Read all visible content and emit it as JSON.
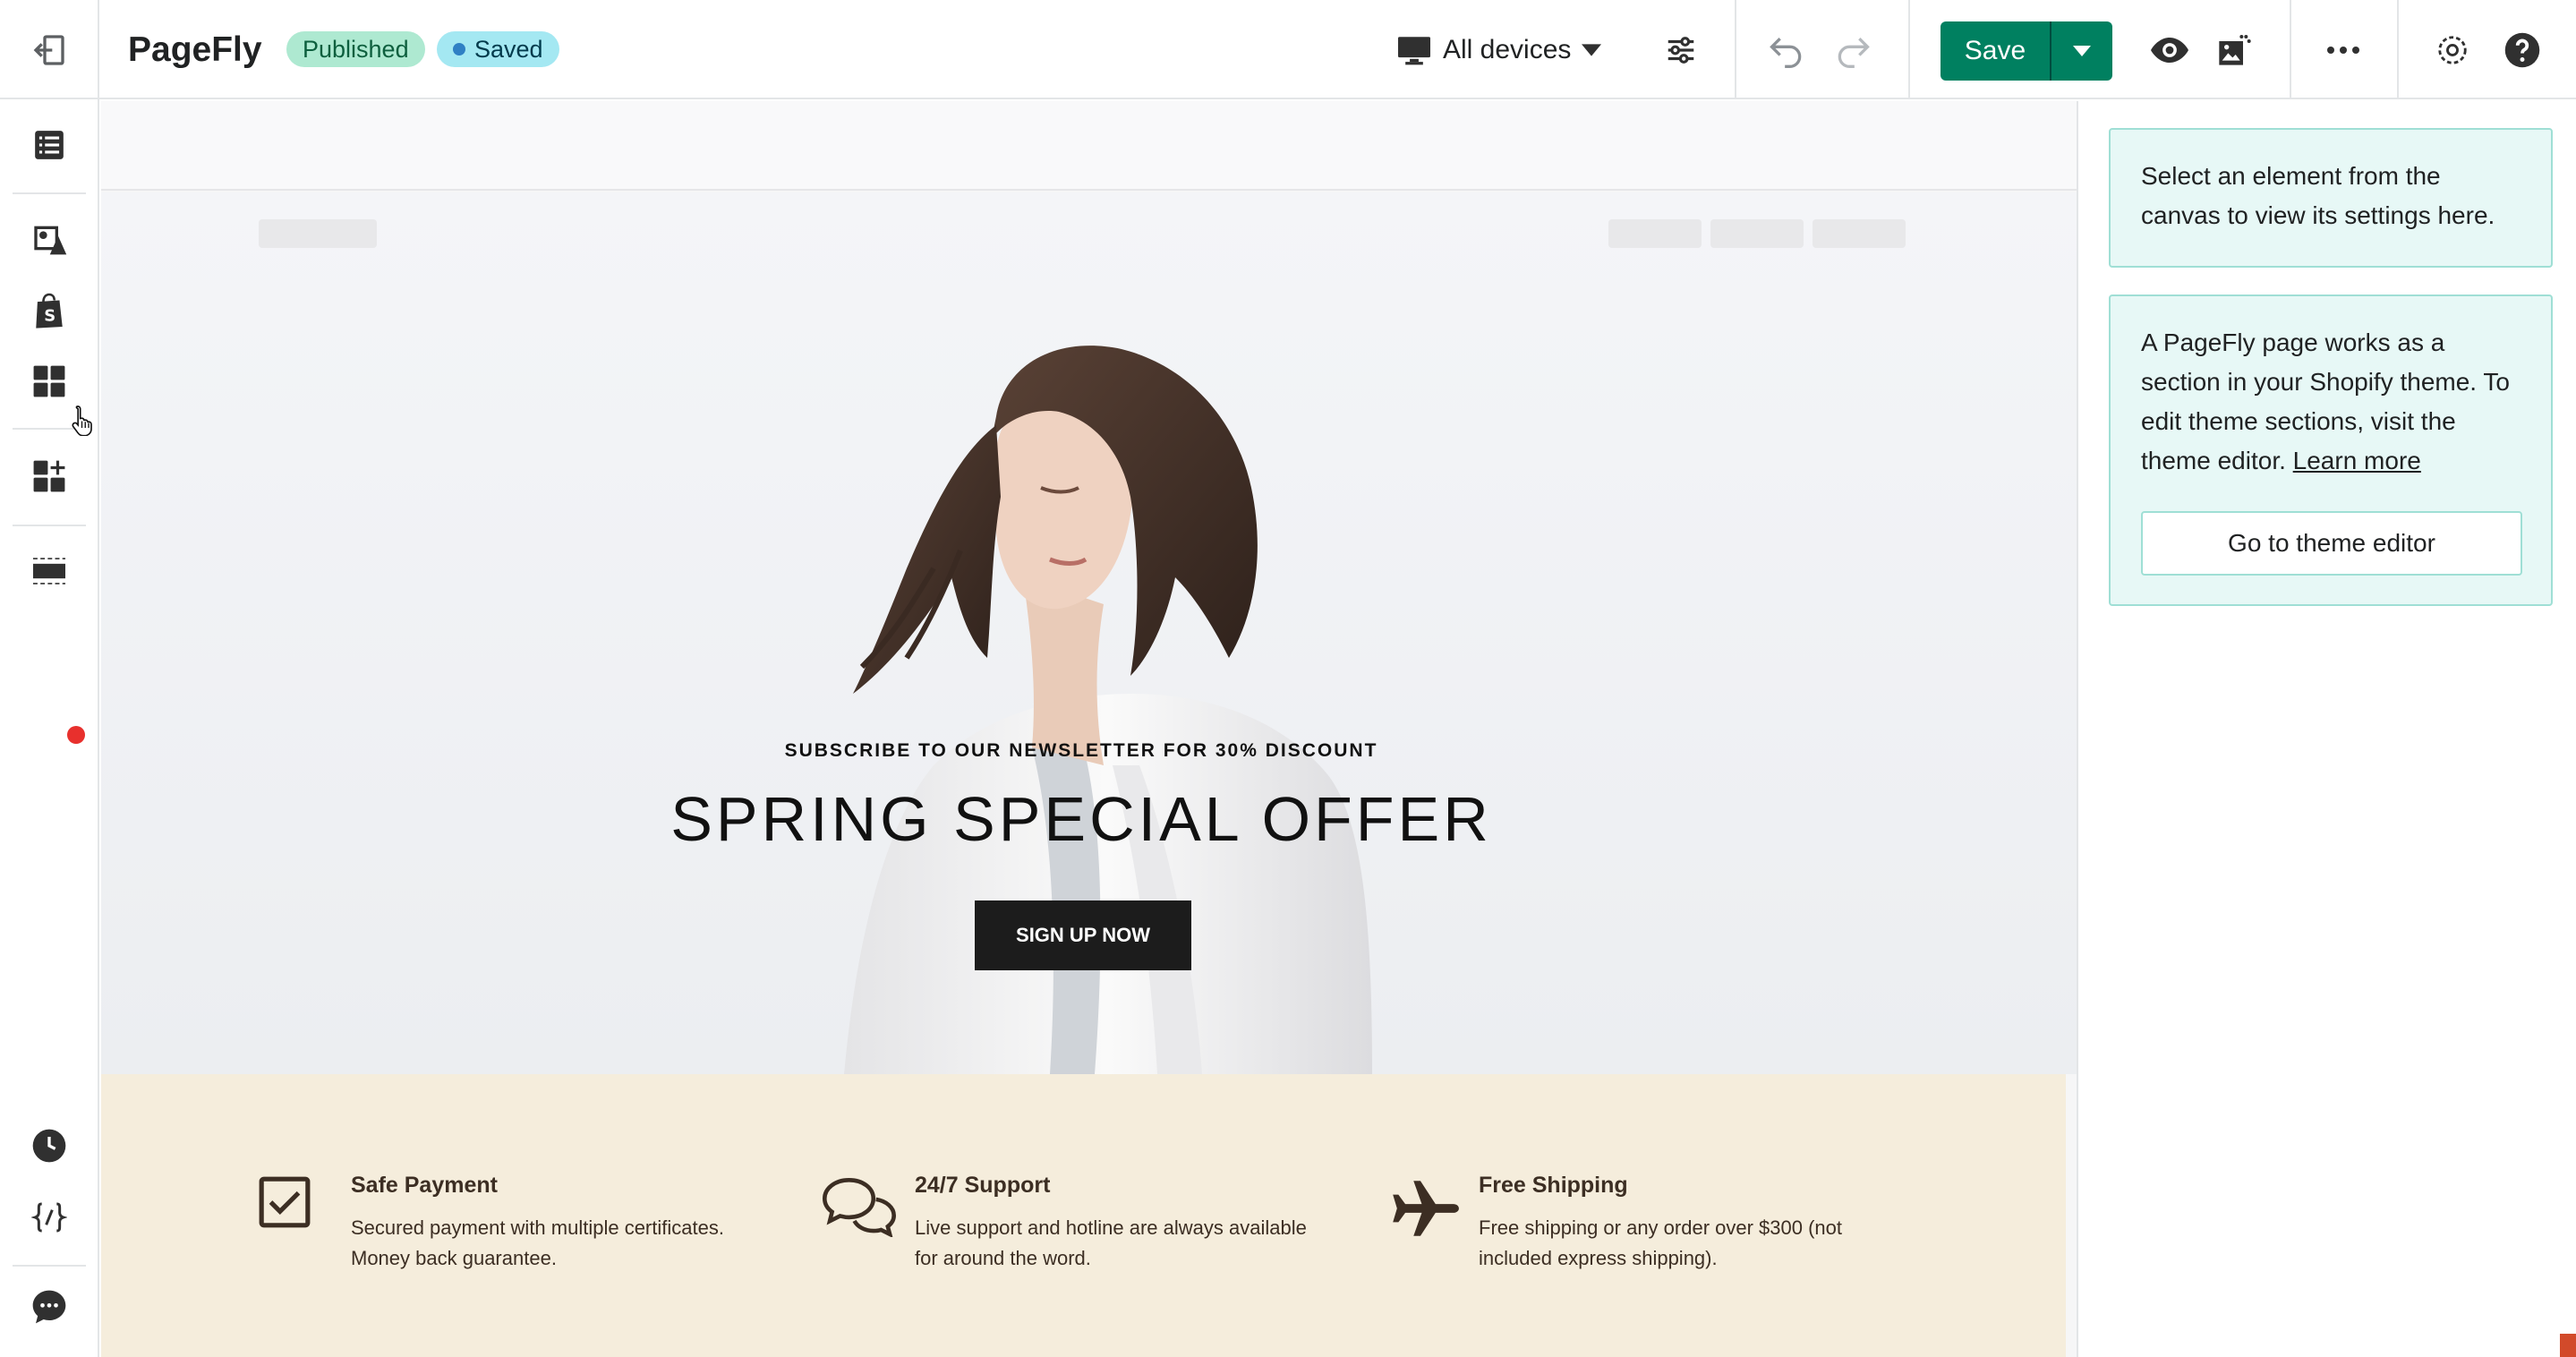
{
  "topbar": {
    "app_title": "PageFly",
    "status_published": "Published",
    "status_saved": "Saved",
    "device_selector": "All devices",
    "save_label": "Save"
  },
  "canvas": {
    "hero": {
      "subtitle": "SUBSCRIBE TO OUR NEWSLETTER FOR 30% DISCOUNT",
      "title": "SPRING SPECIAL OFFER",
      "cta": "SIGN UP NOW"
    },
    "features": [
      {
        "icon": "checkbox-icon",
        "title": "Safe Payment",
        "description": "Secured payment with multiple certificates. Money back guarantee."
      },
      {
        "icon": "chat-bubbles-icon",
        "title": "24/7 Support",
        "description": "Live support and hotline are always available for around the word."
      },
      {
        "icon": "airplane-icon",
        "title": "Free Shipping",
        "description": "Free shipping or any order over $300 (not included express shipping)."
      }
    ]
  },
  "right_panel": {
    "hint": "Select an element from the canvas to view its settings here.",
    "info_text": "A PageFly page works as a section in your Shopify theme. To edit theme sections, visit the theme editor.",
    "learn_more": "Learn more",
    "theme_editor_button": "Go to theme editor"
  },
  "colors": {
    "save_green": "#008060",
    "published_badge": "#aee9d1",
    "saved_badge": "#a4e8f2",
    "panel_card_bg": "#e7f8f6",
    "features_bg": "#f5eddc",
    "notification_dot": "#e8302d"
  }
}
